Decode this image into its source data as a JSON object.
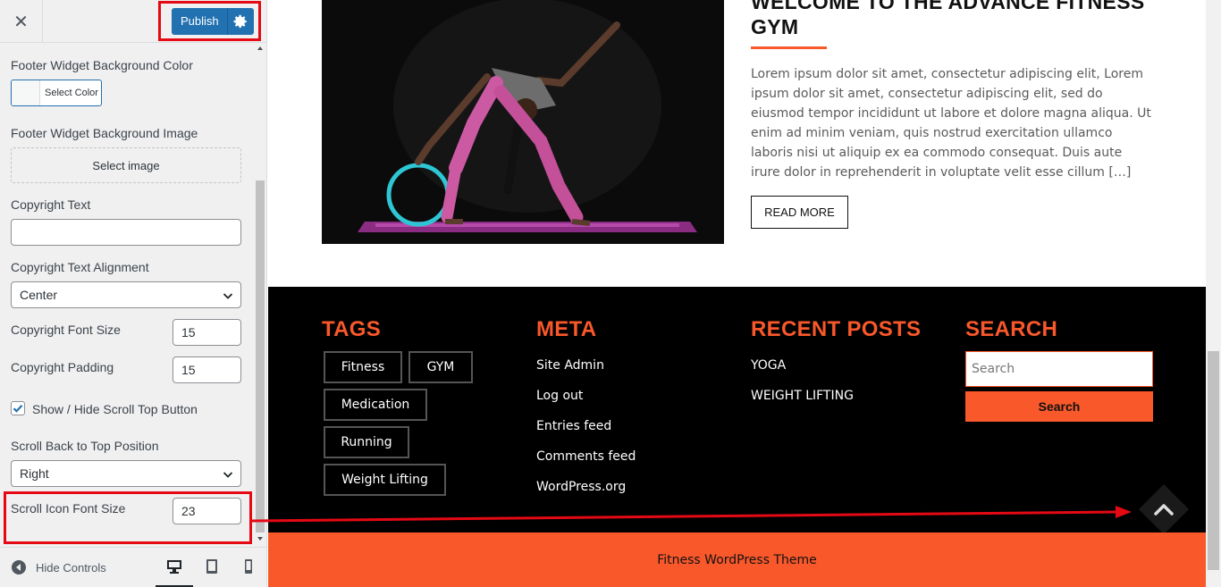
{
  "header": {
    "close_icon": "close-icon",
    "publish_label": "Publish",
    "publish_gear": "gear-icon"
  },
  "controls": {
    "footer_bg_color_label": "Footer Widget Background Color",
    "select_color": "Select Color",
    "footer_bg_image_label": "Footer Widget Background Image",
    "select_image": "Select image",
    "copyright_text_label": "Copyright Text",
    "copyright_text_value": "",
    "copyright_alignment_label": "Copyright Text Alignment",
    "copyright_alignment_value": "Center",
    "copyright_font_size_label": "Copyright Font Size",
    "copyright_font_size_value": "15",
    "copyright_padding_label": "Copyright Padding",
    "copyright_padding_value": "15",
    "scroll_top_toggle_label": "Show / Hide Scroll Top Button",
    "scroll_top_toggle_checked": true,
    "scroll_position_label": "Scroll Back to Top Position",
    "scroll_position_value": "Right",
    "scroll_icon_size_label": "Scroll Icon Font Size",
    "scroll_icon_size_value": "23"
  },
  "footer_bar": {
    "hide_controls": "Hide Controls",
    "devices": [
      "desktop",
      "tablet",
      "mobile"
    ],
    "active_device": "desktop"
  },
  "post": {
    "title": "WELCOME TO THE ADVANCE FITNESS GYM",
    "excerpt": "Lorem ipsum dolor sit amet, consectetur adipiscing elit, Lorem ipsum dolor sit amet, consectetur adipiscing elit, sed do eiusmod tempor incididunt ut labore et dolore magna aliqua. Ut enim ad minim veniam, quis nostrud exercitation ullamco laboris nisi ut aliquip ex ea commodo consequat. Duis aute irure dolor in reprehenderit in voluptate velit esse cillum […]",
    "read_more": "READ MORE"
  },
  "footer": {
    "tags_heading": "TAGS",
    "tags": [
      "Fitness",
      "GYM",
      "Medication",
      "Running",
      "Weight Lifting"
    ],
    "meta_heading": "META",
    "meta_links": [
      "Site Admin",
      "Log out",
      "Entries feed",
      "Comments feed",
      "WordPress.org"
    ],
    "recent_heading": "RECENT POSTS",
    "recent_posts": [
      "YOGA",
      "WEIGHT LIFTING"
    ],
    "search_heading": "SEARCH",
    "search_placeholder": "Search",
    "search_button": "Search",
    "copyright": "Fitness WordPress Theme"
  },
  "colors": {
    "accent": "#f9582a",
    "publish": "#2271b1",
    "highlight": "#e50914",
    "footer_bg": "#000000"
  }
}
